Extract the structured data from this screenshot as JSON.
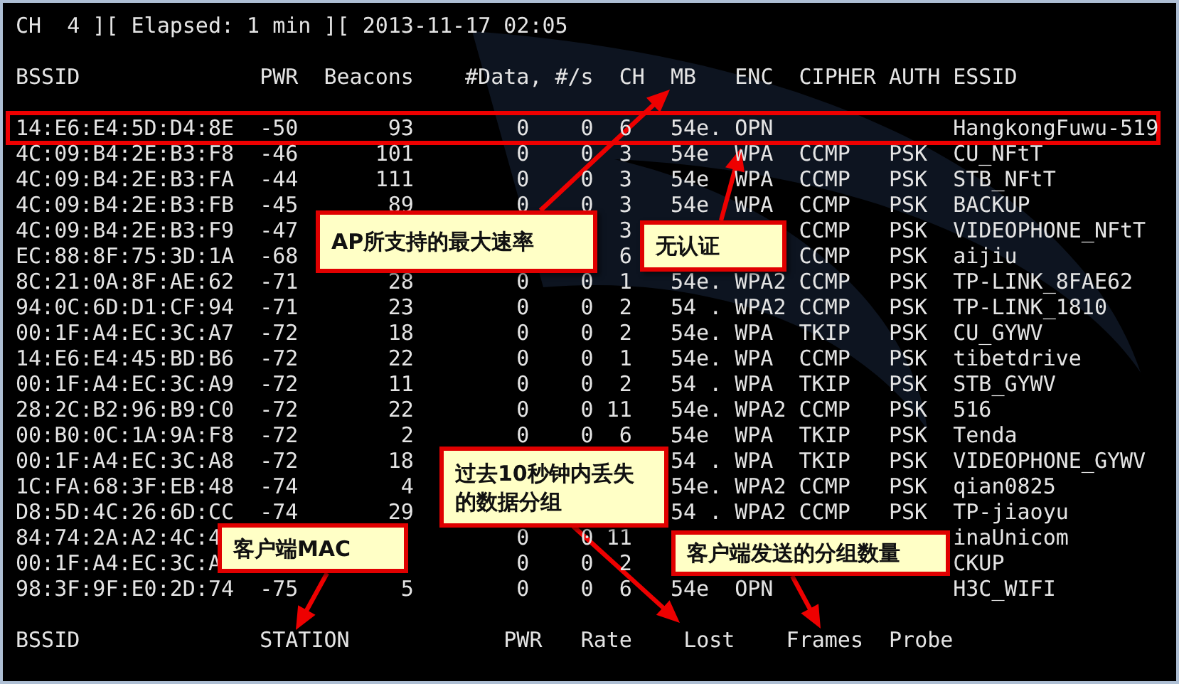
{
  "status_line": "CH  4 ][ Elapsed: 1 min ][ 2013-11-17 02:05",
  "ap_table": {
    "columns": [
      "BSSID",
      "PWR",
      "Beacons",
      "#Data, #/s",
      "CH",
      "MB",
      "ENC",
      "CIPHER",
      "AUTH",
      "ESSID"
    ],
    "rows": [
      {
        "highlighted": true,
        "bssid": "14:E6:E4:5D:D4:8E",
        "pwr": "-50",
        "beacons": "93",
        "data": "0",
        "per_s": "0",
        "ch": "6",
        "mb": "54e.",
        "enc": "OPN",
        "essid": "HangkongFuwu-519"
      },
      {
        "highlighted": false,
        "bssid": "4C:09:B4:2E:B3:F8",
        "pwr": "-46",
        "beacons": "101",
        "data": "0",
        "per_s": "0",
        "ch": "3",
        "mb": "54e",
        "enc": "WPA",
        "cipher": "CCMP",
        "auth": "PSK",
        "essid": "CU_NFtT"
      },
      {
        "highlighted": false,
        "bssid": "4C:09:B4:2E:B3:FA",
        "pwr": "-44",
        "beacons": "111",
        "data": "0",
        "per_s": "0",
        "ch": "3",
        "mb": "54e",
        "enc": "WPA",
        "cipher": "CCMP",
        "auth": "PSK",
        "essid": "STB_NFtT"
      },
      {
        "highlighted": false,
        "bssid": "4C:09:B4:2E:B3:FB",
        "pwr": "-45",
        "beacons": "89",
        "data": "0",
        "per_s": "0",
        "ch": "3",
        "mb": "54e",
        "enc": "WPA",
        "cipher": "CCMP",
        "auth": "PSK",
        "essid": "BACKUP"
      },
      {
        "highlighted": false,
        "bssid": "4C:09:B4:2E:B3:F9",
        "pwr": "-47",
        "ch": "3",
        "cipher": "CCMP",
        "auth": "PSK",
        "essid": "VIDEOPHONE_NFtT"
      },
      {
        "highlighted": false,
        "bssid": "EC:88:8F:75:3D:1A",
        "pwr": "-68",
        "ch": "6",
        "cipher": "CCMP",
        "auth": "PSK",
        "essid": "aijiu"
      },
      {
        "highlighted": false,
        "bssid": "8C:21:0A:8F:AE:62",
        "pwr": "-71",
        "beacons": "28",
        "data": "0",
        "per_s": "0",
        "ch": "1",
        "mb": "54e.",
        "enc": "WPA2",
        "cipher": "CCMP",
        "auth": "PSK",
        "essid": "TP-LINK_8FAE62"
      },
      {
        "highlighted": false,
        "bssid": "94:0C:6D:D1:CF:94",
        "pwr": "-71",
        "beacons": "23",
        "data": "0",
        "per_s": "0",
        "ch": "2",
        "mb": "54 .",
        "enc": "WPA2",
        "cipher": "CCMP",
        "auth": "PSK",
        "essid": "TP-LINK_1810"
      },
      {
        "highlighted": false,
        "bssid": "00:1F:A4:EC:3C:A7",
        "pwr": "-72",
        "beacons": "18",
        "data": "0",
        "per_s": "0",
        "ch": "2",
        "mb": "54e.",
        "enc": "WPA",
        "cipher": "TKIP",
        "auth": "PSK",
        "essid": "CU_GYWV"
      },
      {
        "highlighted": false,
        "bssid": "14:E6:E4:45:BD:B6",
        "pwr": "-72",
        "beacons": "22",
        "data": "0",
        "per_s": "0",
        "ch": "1",
        "mb": "54e.",
        "enc": "WPA",
        "cipher": "CCMP",
        "auth": "PSK",
        "essid": "tibetdrive"
      },
      {
        "highlighted": false,
        "bssid": "00:1F:A4:EC:3C:A9",
        "pwr": "-72",
        "beacons": "11",
        "data": "0",
        "per_s": "0",
        "ch": "2",
        "mb": "54 .",
        "enc": "WPA",
        "cipher": "TKIP",
        "auth": "PSK",
        "essid": "STB_GYWV"
      },
      {
        "highlighted": false,
        "bssid": "28:2C:B2:96:B9:C0",
        "pwr": "-72",
        "beacons": "22",
        "data": "0",
        "per_s": "0",
        "ch": "11",
        "mb": "54e.",
        "enc": "WPA2",
        "cipher": "CCMP",
        "auth": "PSK",
        "essid": "516"
      },
      {
        "highlighted": false,
        "bssid": "00:B0:0C:1A:9A:F8",
        "pwr": "-72",
        "beacons": "2",
        "data": "0",
        "per_s": "0",
        "ch": "6",
        "mb": "54e",
        "enc": "WPA",
        "cipher": "TKIP",
        "auth": "PSK",
        "essid": "Tenda"
      },
      {
        "highlighted": false,
        "bssid": "00:1F:A4:EC:3C:A8",
        "pwr": "-72",
        "beacons": "18",
        "mb": "54 .",
        "enc": "WPA",
        "cipher": "TKIP",
        "auth": "PSK",
        "essid": "VIDEOPHONE_GYWV"
      },
      {
        "highlighted": false,
        "bssid": "1C:FA:68:3F:EB:48",
        "pwr": "-74",
        "beacons": "4",
        "mb": "54e.",
        "enc": "WPA2",
        "cipher": "CCMP",
        "auth": "PSK",
        "essid": "qian0825"
      },
      {
        "highlighted": false,
        "bssid": "D8:5D:4C:26:6D:CC",
        "pwr": "-74",
        "beacons": "29",
        "mb": "54 .",
        "enc": "WPA2",
        "cipher": "CCMP",
        "auth": "PSK",
        "essid": "TP-jiaoyu"
      },
      {
        "highlighted": false,
        "bssid": "84:74:2A:A2:4C:4",
        "data": "0",
        "per_s": "0",
        "ch": "11",
        "essid": "inaUnicom"
      },
      {
        "highlighted": false,
        "bssid": "00:1F:A4:EC:3C:A",
        "data": "0",
        "per_s": "0",
        "ch": "2",
        "essid": "CKUP"
      },
      {
        "highlighted": false,
        "bssid": "98:3F:9F:E0:2D:74",
        "pwr": "-75",
        "beacons": "5",
        "data": "0",
        "per_s": "0",
        "ch": "6",
        "mb": "54e",
        "enc": "OPN",
        "essid": "H3C_WIFI"
      }
    ]
  },
  "station_table": {
    "columns": [
      "BSSID",
      "STATION",
      "PWR",
      "Rate",
      "Lost",
      "Frames",
      "Probe"
    ]
  },
  "callouts": [
    {
      "text": "AP所支持的最大速率"
    },
    {
      "text": "无认证"
    },
    {
      "text": "过去10秒钟内丢失的数据分组"
    },
    {
      "text": "客户端MAC"
    },
    {
      "text": "客户端发送的分组数量"
    }
  ]
}
